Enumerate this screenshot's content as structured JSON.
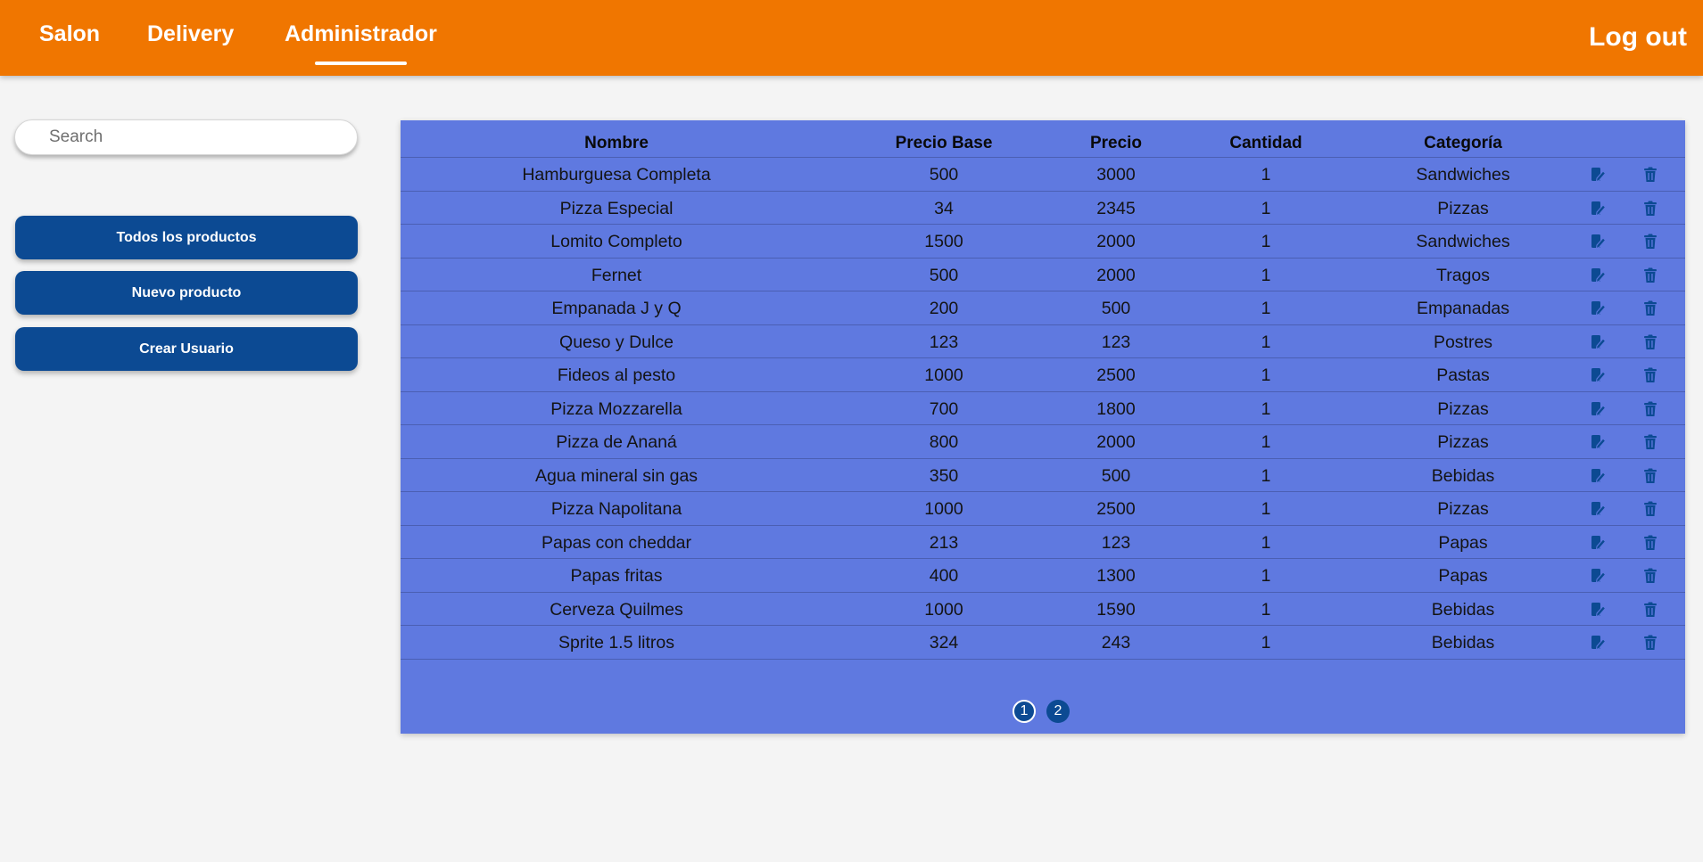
{
  "nav": {
    "items": [
      {
        "label": "Salon"
      },
      {
        "label": "Delivery"
      },
      {
        "label": "Administrador"
      }
    ],
    "active": "Administrador",
    "logout_label": "Log out"
  },
  "sidebar": {
    "search_placeholder": "Search",
    "buttons": [
      {
        "label": "Todos los productos"
      },
      {
        "label": "Nuevo producto"
      },
      {
        "label": "Crear Usuario"
      }
    ]
  },
  "table": {
    "headers": [
      "Nombre",
      "Precio Base",
      "Precio",
      "Cantidad",
      "Categoría"
    ],
    "rows": [
      {
        "nombre": "Hamburguesa Completa",
        "precio_base": "500",
        "precio": "3000",
        "cantidad": "1",
        "categoria": "Sandwiches"
      },
      {
        "nombre": "Pizza Especial",
        "precio_base": "34",
        "precio": "2345",
        "cantidad": "1",
        "categoria": "Pizzas"
      },
      {
        "nombre": "Lomito Completo",
        "precio_base": "1500",
        "precio": "2000",
        "cantidad": "1",
        "categoria": "Sandwiches"
      },
      {
        "nombre": "Fernet",
        "precio_base": "500",
        "precio": "2000",
        "cantidad": "1",
        "categoria": "Tragos"
      },
      {
        "nombre": "Empanada J y Q",
        "precio_base": "200",
        "precio": "500",
        "cantidad": "1",
        "categoria": "Empanadas"
      },
      {
        "nombre": "Queso y Dulce",
        "precio_base": "123",
        "precio": "123",
        "cantidad": "1",
        "categoria": "Postres"
      },
      {
        "nombre": "Fideos al pesto",
        "precio_base": "1000",
        "precio": "2500",
        "cantidad": "1",
        "categoria": "Pastas"
      },
      {
        "nombre": "Pizza Mozzarella",
        "precio_base": "700",
        "precio": "1800",
        "cantidad": "1",
        "categoria": "Pizzas"
      },
      {
        "nombre": "Pizza de Ananá",
        "precio_base": "800",
        "precio": "2000",
        "cantidad": "1",
        "categoria": "Pizzas"
      },
      {
        "nombre": "Agua mineral sin gas",
        "precio_base": "350",
        "precio": "500",
        "cantidad": "1",
        "categoria": "Bebidas"
      },
      {
        "nombre": "Pizza Napolitana",
        "precio_base": "1000",
        "precio": "2500",
        "cantidad": "1",
        "categoria": "Pizzas"
      },
      {
        "nombre": "Papas con cheddar",
        "precio_base": "213",
        "precio": "123",
        "cantidad": "1",
        "categoria": "Papas"
      },
      {
        "nombre": "Papas fritas",
        "precio_base": "400",
        "precio": "1300",
        "cantidad": "1",
        "categoria": "Papas"
      },
      {
        "nombre": "Cerveza Quilmes",
        "precio_base": "1000",
        "precio": "1590",
        "cantidad": "1",
        "categoria": "Bebidas"
      },
      {
        "nombre": "Sprite 1.5 litros",
        "precio_base": "324",
        "precio": "243",
        "cantidad": "1",
        "categoria": "Bebidas"
      }
    ],
    "row_icons": [
      "edit-icon",
      "trash-icon"
    ]
  },
  "pagination": {
    "pages": [
      "1",
      "2"
    ],
    "current": "1"
  },
  "colors": {
    "topbar": "#f07600",
    "button": "#0c4a93",
    "panel": "#5f79e0",
    "row_icon": "#0c4a93",
    "background": "#f4f4f4"
  }
}
